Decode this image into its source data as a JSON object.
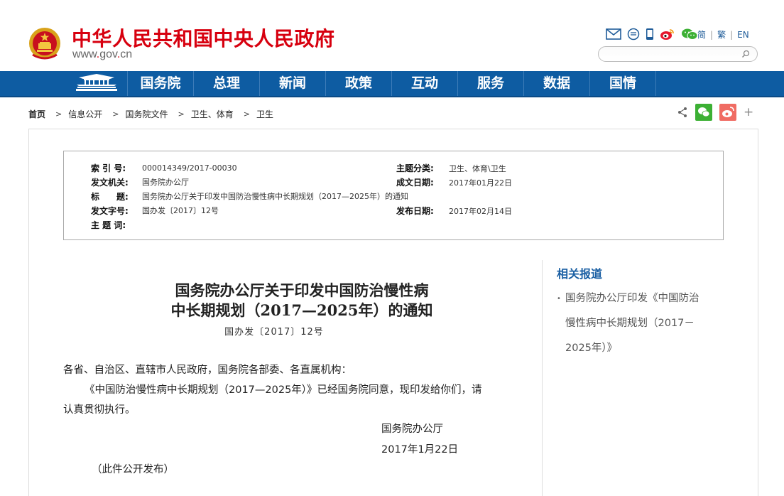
{
  "header": {
    "site_title": "中华人民共和国中央人民政府",
    "domain_prefix": "www",
    "domain_dot1": ".",
    "domain_name": "gov",
    "domain_dot2": ".",
    "domain_tld": "cn",
    "tool_icons": [
      "mail-icon",
      "chat-bubble-icon",
      "mobile-icon",
      "weibo-icon",
      "wechat-icon"
    ],
    "lang": {
      "simplified": "简",
      "traditional": "繁",
      "english": "EN"
    },
    "search_value": ""
  },
  "nav": {
    "home_icon": "tiananmen-icon",
    "items": [
      "国务院",
      "总理",
      "新闻",
      "政策",
      "互动",
      "服务",
      "数据",
      "国情"
    ]
  },
  "breadcrumb": [
    "首页",
    "信息公开",
    "国务院文件",
    "卫生、体育",
    "卫生"
  ],
  "share": {
    "icons": [
      "share-icon",
      "wechat-share-icon",
      "weibo-share-icon"
    ],
    "plus": "+"
  },
  "meta": {
    "index_no_label": "索 引 号:",
    "index_no": "000014349/2017-00030",
    "issuer_label": "发文机关:",
    "issuer": "国务院办公厅",
    "title_label": "标　　题:",
    "title": "国务院办公厅关于印发中国防治慢性病中长期规划（2017—2025年）的通知",
    "doc_no_label": "发文字号:",
    "doc_no": "国办发〔2017〕12号",
    "subject_words_label": "主 题 词:",
    "subject_words": "",
    "category_label": "主题分类:",
    "category": "卫生、体育\\卫生",
    "created_label": "成文日期:",
    "created": "2017年01月22日",
    "published_label": "发布日期:",
    "published": "2017年02月14日"
  },
  "article": {
    "title_line1": "国务院办公厅关于印发中国防治慢性病",
    "title_line2": "中长期规划（2017—2025年）的通知",
    "doc_no": "国办发〔2017〕12号",
    "salutation": "各省、自治区、直辖市人民政府，国务院各部委、各直属机构：",
    "body_line1": "《中国防治慢性病中长期规划（2017—2025年）》已经国务院同意，现印发给你们，请",
    "body_line2": "认真贯彻执行。",
    "signature": "国务院办公厅",
    "date": "2017年1月22日",
    "note": "（此件公开发布）"
  },
  "sidebar": {
    "title": "相关报道",
    "bullet": "•",
    "items": [
      {
        "line1": "国务院办公厅印发《中国防治",
        "line2": "慢性病中长期规划（2017－",
        "line3": "2025年）》"
      }
    ]
  },
  "colors": {
    "brand_red": "#d7000f",
    "nav_blue": "#0e5ca2",
    "link_blue": "#1a5fa3",
    "wechat_green": "#3cb034",
    "weibo_red": "#f06c63"
  }
}
